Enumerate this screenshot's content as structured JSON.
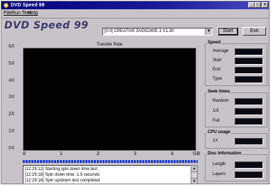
{
  "window": {
    "title": "DVD Speed 99"
  },
  "menu": [
    "File",
    "Run Test",
    "Help"
  ],
  "logo": "DVD Speed 99",
  "drive": {
    "selected": "[0:0]  CREATIVE DVD5240E-1 V1.30"
  },
  "buttons": {
    "start": "Start",
    "exit": "Exit"
  },
  "chart_data": {
    "type": "line",
    "title": "Transfer Rate",
    "y_ticks": [
      "6X",
      "5X",
      "4X",
      "3X",
      "2X",
      "1X",
      "0X"
    ],
    "x_ticks": [
      "0",
      "1",
      "2",
      "3",
      "4",
      "GB"
    ],
    "series": []
  },
  "log": [
    "[12:29:12]  Starting spin down time test",
    "[12:29:18]  Spin down time: 1.5 seconds",
    "[12:29:18]  Spin up/down test completed"
  ],
  "speed": {
    "title": "Speed",
    "rows": [
      {
        "label": "Average",
        "value": ""
      },
      {
        "label": "Start",
        "value": ""
      },
      {
        "label": "End",
        "value": ""
      },
      {
        "label": "Type",
        "value": ""
      }
    ]
  },
  "seek": {
    "title": "Seek times",
    "rows": [
      {
        "label": "Random",
        "value": ""
      },
      {
        "label": "1/3",
        "value": ""
      },
      {
        "label": "Full",
        "value": ""
      }
    ]
  },
  "cpu": {
    "title": "CPU usage",
    "rows": [
      {
        "label": "1X",
        "value": ""
      }
    ]
  },
  "disc": {
    "title": "Disc Information",
    "rows": [
      {
        "label": "Length",
        "value": ""
      },
      {
        "label": "Layers",
        "value": ""
      }
    ]
  }
}
